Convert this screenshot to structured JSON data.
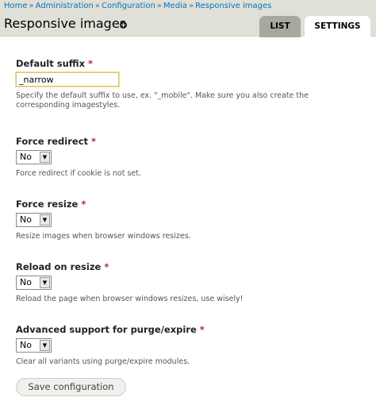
{
  "breadcrumb": {
    "items": [
      "Home",
      "Administration",
      "Configuration",
      "Media",
      "Responsive images"
    ],
    "separator": "»"
  },
  "page": {
    "title": "Responsive images",
    "shortcut_icon": "plus-circle-icon"
  },
  "tabs": [
    {
      "label": "LIST",
      "active": false
    },
    {
      "label": "SETTINGS",
      "active": true
    }
  ],
  "form": {
    "default_suffix": {
      "label": "Default suffix",
      "required": "*",
      "value": "_narrow",
      "description_line1": "Specify the default suffix to use, ex. \"_mobile\". Make sure you also create the",
      "description_line2": "corresponding imagestyles."
    },
    "force_redirect": {
      "label": "Force redirect",
      "required": "*",
      "value": "No",
      "description": "Force redirect if cookie is not set."
    },
    "force_resize": {
      "label": "Force resize",
      "required": "*",
      "value": "No",
      "description": "Resize images when browser windows resizes."
    },
    "reload_on_resize": {
      "label": "Reload on resize",
      "required": "*",
      "value": "No",
      "description": "Reload the page when browser windows resizes, use wisely!"
    },
    "purge_expire": {
      "label": "Advanced support for purge/expire",
      "required": "*",
      "value": "No",
      "description": "Clear all variants using purge/expire modules."
    },
    "save_label": "Save configuration"
  },
  "colors": {
    "link": "#0074bd",
    "header_bg": "#e0e0d8",
    "required": "#b62b2b",
    "inactive_tab": "#a8a8a0"
  }
}
